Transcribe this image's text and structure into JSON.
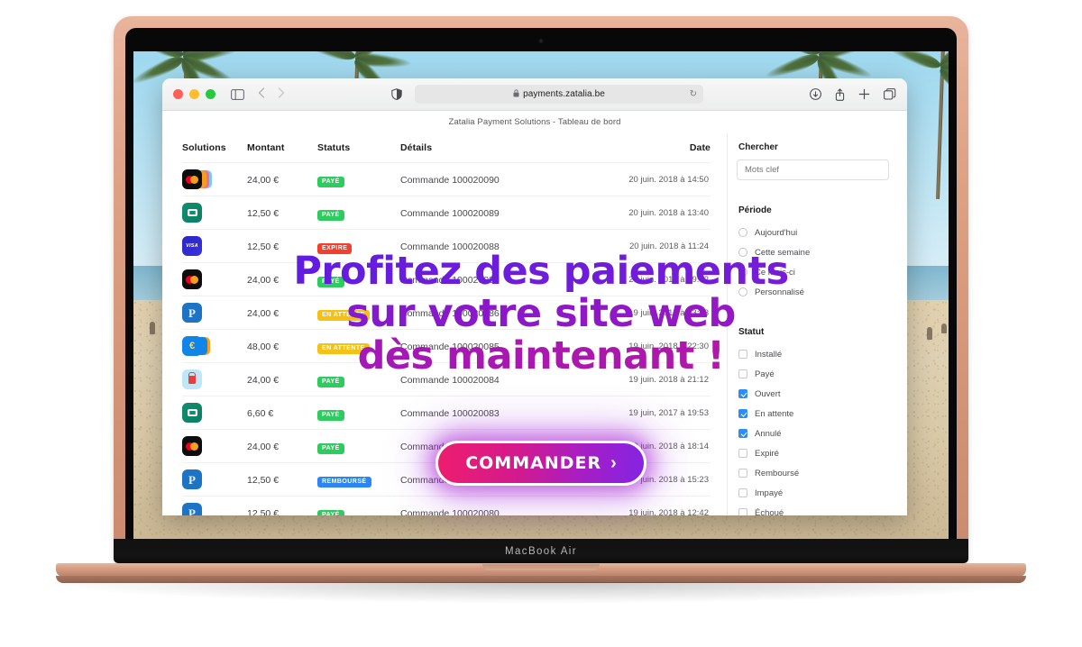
{
  "device": {
    "label": "MacBook Air"
  },
  "browser": {
    "url": "payments.zatalia.be",
    "lock_glyph": "🔒",
    "reload_glyph": "↻",
    "page_title": "Zatalia Payment Solutions - Tableau de bord",
    "traffic_lights": [
      "close",
      "minimize",
      "zoom"
    ],
    "icons": {
      "sidebar": "sidebar-icon",
      "back": "back-chevron-icon",
      "forward": "forward-chevron-icon",
      "shield": "privacy-shield-icon",
      "download": "download-icon",
      "share": "share-icon",
      "new_tab": "plus-icon",
      "tab_overview": "tab-overview-icon"
    }
  },
  "table": {
    "headers": {
      "solutions": "Solutions",
      "montant": "Montant",
      "statuts": "Statuts",
      "details": "Détails",
      "date": "Date"
    },
    "rows": [
      {
        "icon": "mastercard-stack",
        "amount": "24,00 €",
        "status": "PAYÉ",
        "status_color": "#2ecc5f",
        "details": "Commande 100020090",
        "date": "20 juin. 2018 à 14:50"
      },
      {
        "icon": "cb",
        "amount": "12,50 €",
        "status": "PAYÉ",
        "status_color": "#2ecc5f",
        "details": "Commande 100020089",
        "date": "20 juin. 2018 à 13:40"
      },
      {
        "icon": "visa",
        "amount": "12,50 €",
        "status": "EXPIRE",
        "status_color": "#f1402e",
        "details": "Commande 100020088",
        "date": "20 juin. 2018 à 11:24"
      },
      {
        "icon": "mastercard",
        "amount": "24,00 €",
        "status": "PAYÉ",
        "status_color": "#2ecc5f",
        "details": "Commande 100020087",
        "date": "20 juin. 2018 à 09:42"
      },
      {
        "icon": "paypal",
        "amount": "24,00 €",
        "status": "EN ATTENTE",
        "status_color": "#f5c116",
        "details": "Commande 100020086",
        "date": "19 juin. 2018 à 23:53"
      },
      {
        "icon": "euro-stack",
        "amount": "48,00 €",
        "status": "EN ATTENTE",
        "status_color": "#f5c116",
        "details": "Commande 100020085",
        "date": "19 juin. 2018 à 22:30"
      },
      {
        "icon": "lock",
        "amount": "24,00 €",
        "status": "PAYÉ",
        "status_color": "#2ecc5f",
        "details": "Commande 100020084",
        "date": "19 juin. 2018 à 21:12"
      },
      {
        "icon": "cb",
        "amount": "6,60 €",
        "status": "PAYÉ",
        "status_color": "#2ecc5f",
        "details": "Commande 100020083",
        "date": "19 juin, 2017 à 19:53"
      },
      {
        "icon": "mastercard",
        "amount": "24,00 €",
        "status": "PAYÉ",
        "status_color": "#2ecc5f",
        "details": "Commande 100020082",
        "date": "19 juin. 2018 à 18:14"
      },
      {
        "icon": "paypal",
        "amount": "12,50 €",
        "status": "REMBOURSÉ",
        "status_color": "#2d84f5",
        "details": "Commande 100020081",
        "date": "19 juin. 2018 à 15:23"
      },
      {
        "icon": "paypal",
        "amount": "12,50 €",
        "status": "PAYÉ",
        "status_color": "#2ecc5f",
        "details": "Commande 100020080",
        "date": "19 juin. 2018 à 12:42"
      }
    ]
  },
  "sidebar": {
    "search_heading": "Chercher",
    "search_placeholder": "Mots clef",
    "search_value": "",
    "periode_heading": "Période",
    "periode_options": [
      {
        "label": "Aujourd'hui",
        "selected": false
      },
      {
        "label": "Cette semaine",
        "selected": false
      },
      {
        "label": "Ce mois-ci",
        "selected": false
      },
      {
        "label": "Personnalisé",
        "selected": false
      }
    ],
    "statut_heading": "Statut",
    "statut_options": [
      {
        "label": "Installé",
        "checked": false
      },
      {
        "label": "Payé",
        "checked": false
      },
      {
        "label": "Ouvert",
        "checked": true
      },
      {
        "label": "En attente",
        "checked": true
      },
      {
        "label": "Annulé",
        "checked": true
      },
      {
        "label": "Expiré",
        "checked": false
      },
      {
        "label": "Remboursé",
        "checked": false
      },
      {
        "label": "Impayé",
        "checked": false
      },
      {
        "label": "Échoué",
        "checked": false
      }
    ]
  },
  "promo": {
    "line1": "Profitez des paiements",
    "line2": "sur votre site web",
    "line3": "dès maintenant !",
    "cta_label": "COMMANDER",
    "cta_arrow": "›",
    "gradient_start": "#5a1ce2",
    "gradient_end": "#b41aa4",
    "cta_gradient_start": "#ee1d6e",
    "cta_gradient_end": "#8424e4"
  }
}
